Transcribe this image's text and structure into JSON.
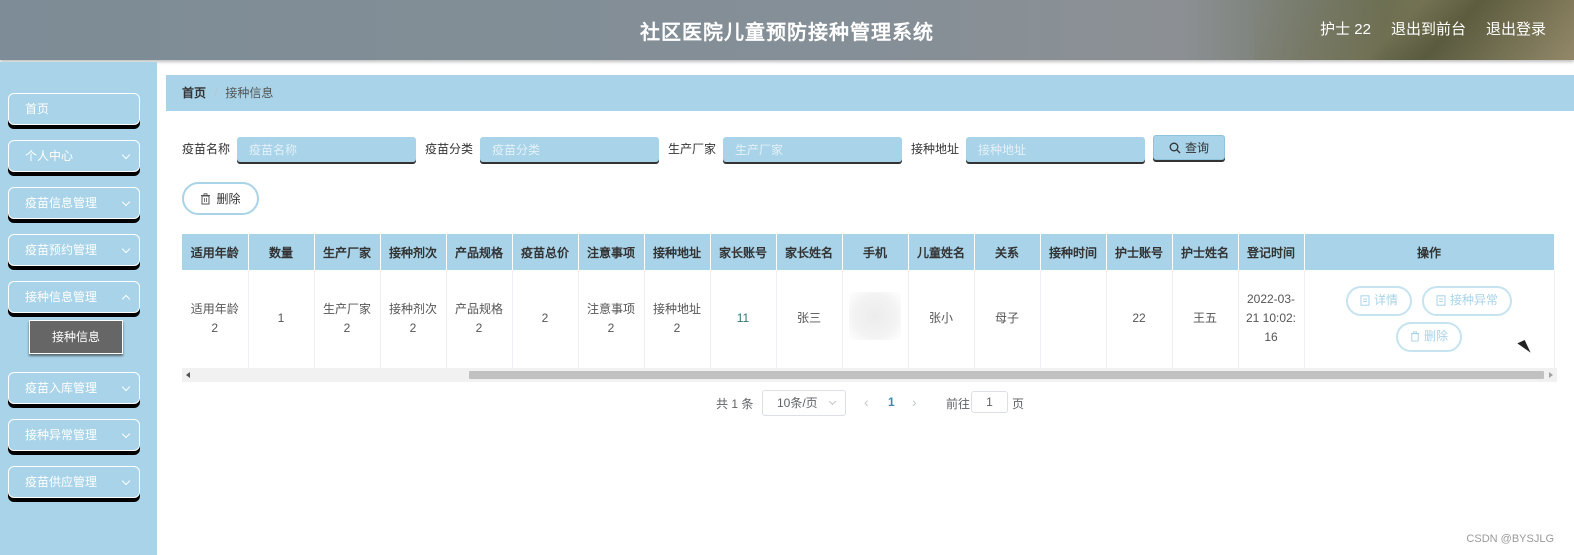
{
  "header": {
    "title": "社区医院儿童预防接种管理系统",
    "user": "护士 22",
    "back_to_front": "退出到前台",
    "logout": "退出登录"
  },
  "sidebar": {
    "items": [
      {
        "label": "首页"
      },
      {
        "label": "个人中心"
      },
      {
        "label": "疫苗信息管理"
      },
      {
        "label": "疫苗预约管理"
      },
      {
        "label": "接种信息管理"
      },
      {
        "label": "疫苗入库管理"
      },
      {
        "label": "接种异常管理"
      },
      {
        "label": "疫苗供应管理"
      }
    ],
    "active_sub": "接种信息"
  },
  "breadcrumb": {
    "home": "首页",
    "separator": "/",
    "current": "接种信息"
  },
  "search": {
    "vaccine_name_label": "疫苗名称",
    "vaccine_name_placeholder": "疫苗名称",
    "vaccine_category_label": "疫苗分类",
    "vaccine_category_placeholder": "疫苗分类",
    "manufacturer_label": "生产厂家",
    "manufacturer_placeholder": "生产厂家",
    "address_label": "接种地址",
    "address_placeholder": "接种地址",
    "query_label": "查询"
  },
  "toolbar": {
    "delete_label": "删除"
  },
  "table": {
    "headers": [
      "适用年龄",
      "数量",
      "生产厂家",
      "接种剂次",
      "产品规格",
      "疫苗总价",
      "注意事项",
      "接种地址",
      "家长账号",
      "家长姓名",
      "手机",
      "儿童姓名",
      "关系",
      "接种时间",
      "护士账号",
      "护士姓名",
      "登记时间",
      "操作"
    ],
    "row": {
      "age": "适用年龄2",
      "quantity": "1",
      "manufacturer": "生产厂家2",
      "dose": "接种剂次2",
      "spec": "产品规格2",
      "total_price": "2",
      "notes": "注意事项2",
      "address": "接种地址2",
      "parent_account": "11",
      "parent_name": "张三",
      "phone": "",
      "child_name": "张小",
      "relation": "母子",
      "vaccination_time": "",
      "nurse_account": "22",
      "nurse_name": "王五",
      "register_time": "2022-03-21 10:02:16"
    },
    "actions": {
      "detail": "详情",
      "abnormal": "接种异常",
      "delete": "删除"
    }
  },
  "pagination": {
    "total": "共 1 条",
    "page_size": "10条/页",
    "current_page": "1",
    "goto_label": "前往",
    "goto_value": "1",
    "page_unit": "页"
  },
  "watermark": "CSDN @BYSJLG"
}
